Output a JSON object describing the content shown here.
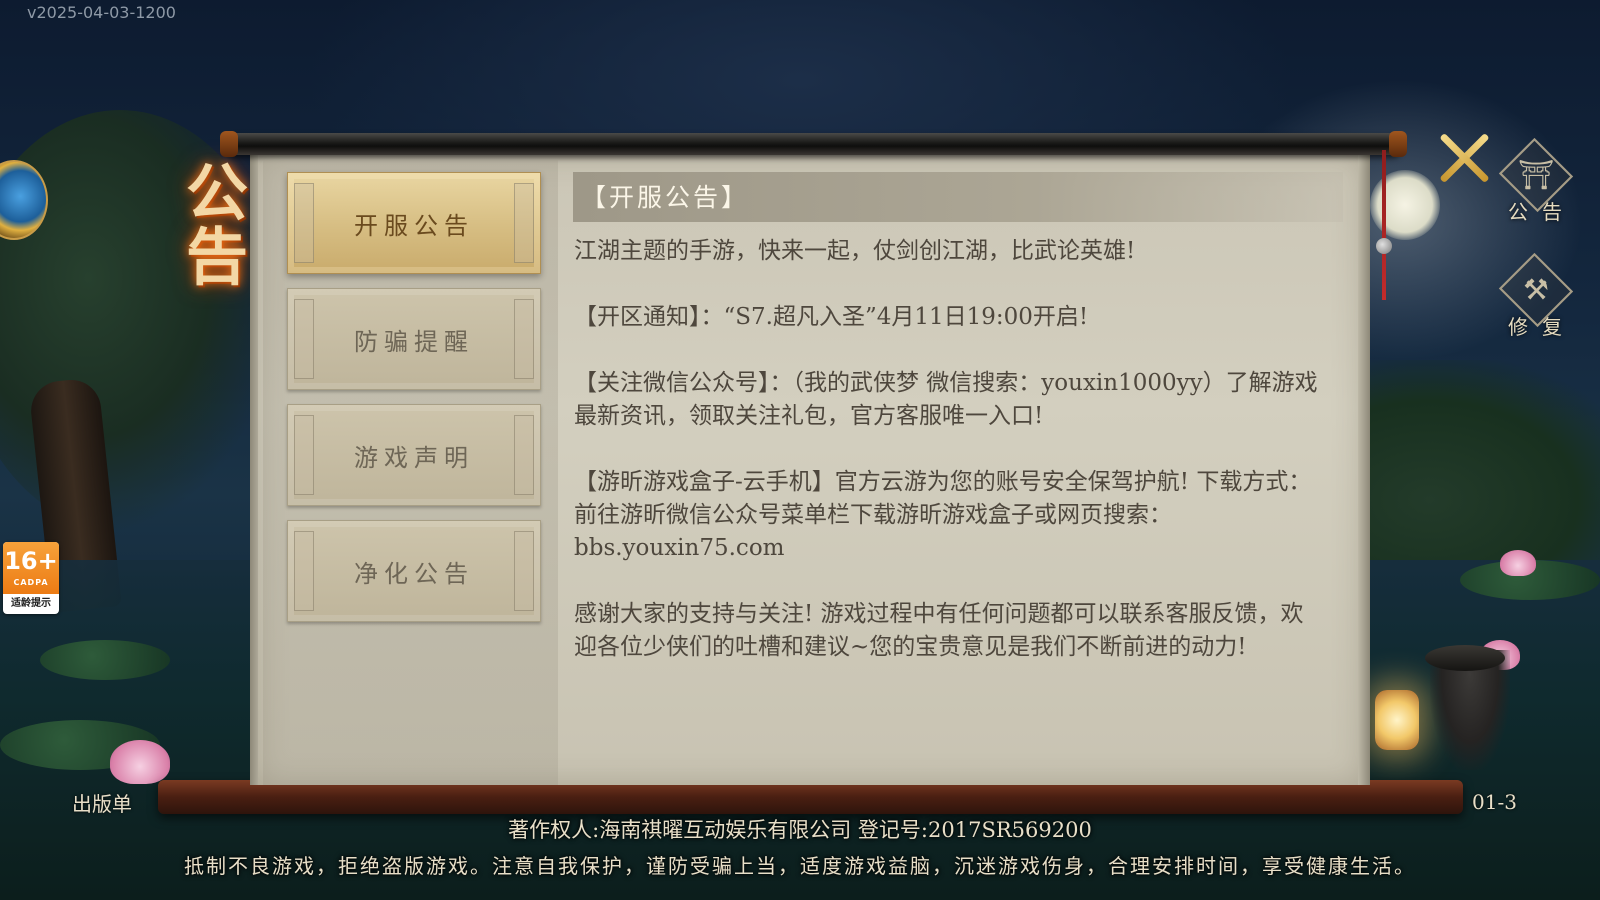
{
  "version": "v2025-04-03-1200",
  "banner_title": "公告",
  "age_rating": {
    "number": "16+",
    "org": "CADPA",
    "label": "适龄提示"
  },
  "tabs": [
    {
      "label": "开服公告",
      "active": true
    },
    {
      "label": "防骗提醒",
      "active": false
    },
    {
      "label": "游戏声明",
      "active": false
    },
    {
      "label": "净化公告",
      "active": false
    }
  ],
  "content": {
    "header": "【开服公告】",
    "paragraphs": [
      "江湖主题的手游，快来一起，仗剑创江湖，比武论英雄!",
      "【开区通知】：“S7.超凡入圣”4月11日19:00开启!",
      "【关注微信公众号】：（我的武侠梦 微信搜索：youxin1000yy）了解游戏最新资讯，领取关注礼包，官方客服唯一入口!",
      "【游昕游戏盒子-云手机】官方云游为您的账号安全保驾护航! 下载方式：前往游昕微信公众号菜单栏下载游昕游戏盒子或网页搜索：bbs.youxin75.com",
      "感谢大家的支持与关注! 游戏过程中有任何问题都可以联系客服反馈，欢迎各位少侠们的吐槽和建议~您的宝贵意见是我们不断前进的动力!"
    ]
  },
  "side_buttons": {
    "announcement": {
      "label": "公告",
      "icon": "gate-icon"
    },
    "repair": {
      "label": "修复",
      "icon": "hammer-icon"
    }
  },
  "footer": {
    "left_fragment": "出版单",
    "right_fragment": "01-3",
    "copyright": "著作权人:海南祺曜互动娱乐有限公司 登记号:2017SR569200",
    "warning": "抵制不良游戏，拒绝盗版游戏。注意自我保护，谨防受骗上当，适度游戏益脑，沉迷游戏伤身，合理安排时间，享受健康生活。"
  },
  "colors": {
    "accent_gold": "#d6bd82",
    "paper": "#cfcab9",
    "text": "#4e473d",
    "banner_glow": "#ff7a1a"
  }
}
